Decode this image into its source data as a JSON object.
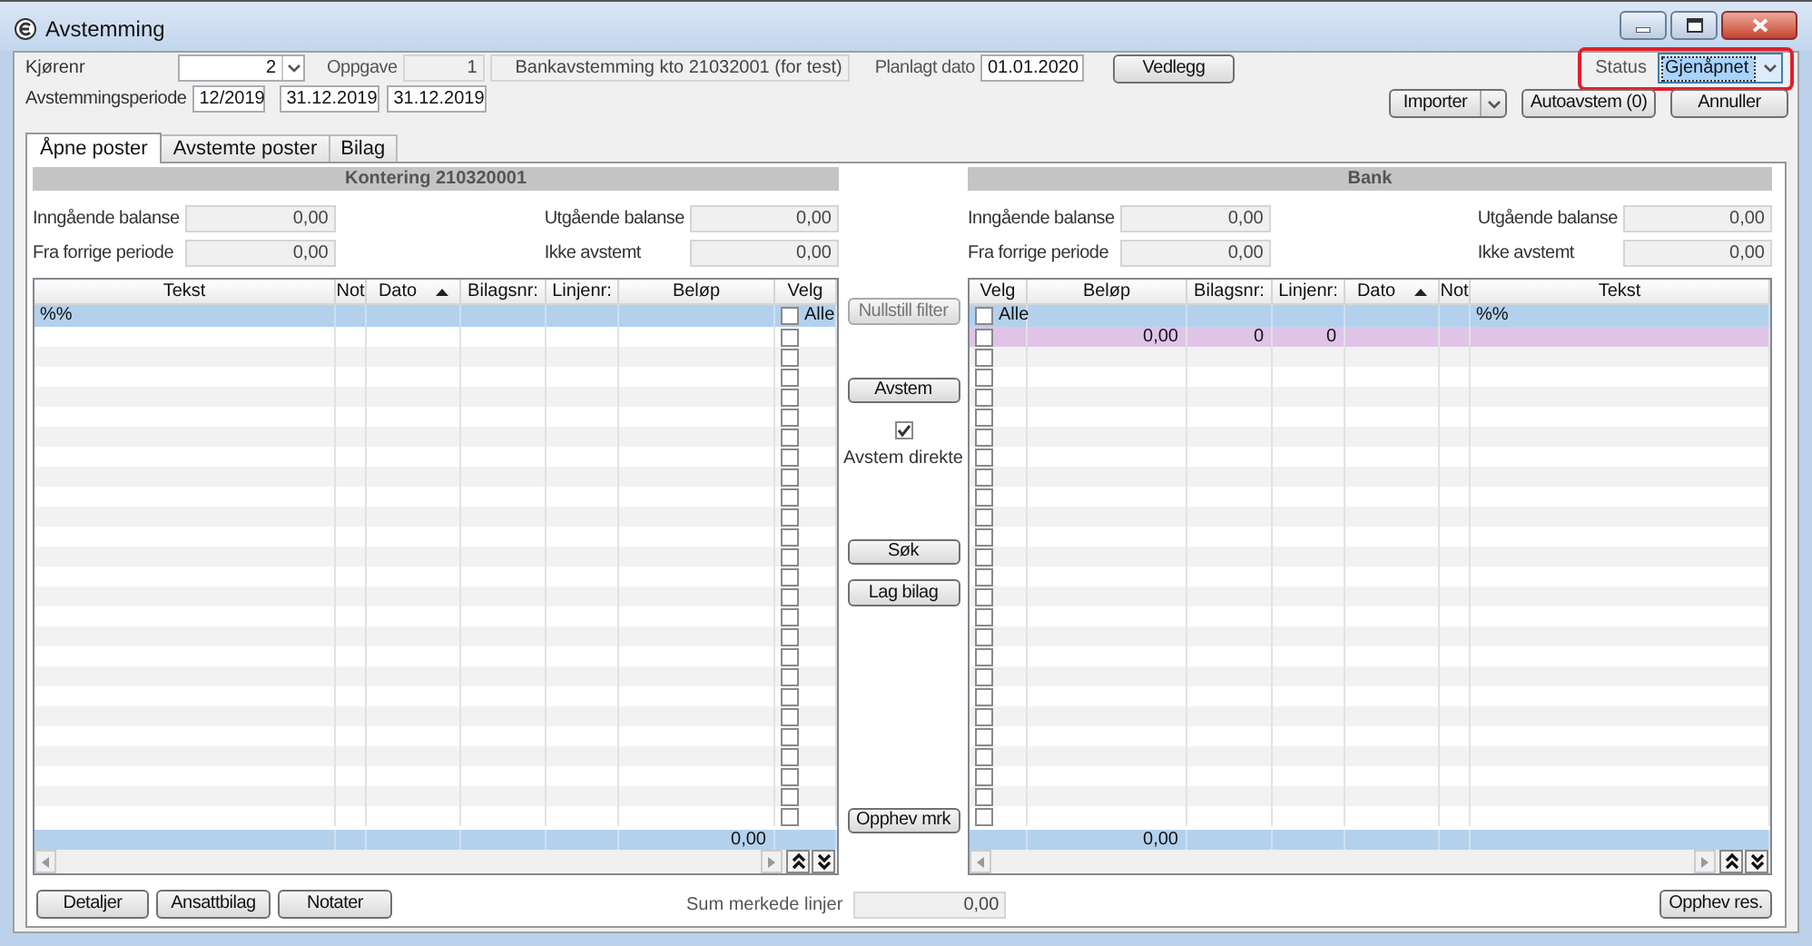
{
  "window": {
    "title": "Avstemming"
  },
  "header": {
    "kjorenr": {
      "label": "Kjørenr",
      "value": "2"
    },
    "oppgave": {
      "label": "Oppgave",
      "number": "1",
      "description": "Bankavstemming kto 21032001 (for test)"
    },
    "planlagt_dato": {
      "label": "Planlagt dato",
      "value": "01.01.2020"
    },
    "vedlegg_button": "Vedlegg",
    "status": {
      "label": "Status",
      "value": "Gjenåpnet",
      "highlighted": true
    },
    "period": {
      "label": "Avstemmingsperiode",
      "values": [
        "12/2019",
        "31.12.2019",
        "31.12.2019"
      ]
    },
    "buttons": [
      {
        "label": "Importer",
        "kind": "split"
      },
      {
        "label": "Autoavstem (0)",
        "kind": "plain"
      },
      {
        "label": "Annuller",
        "kind": "plain"
      }
    ]
  },
  "tabs": [
    {
      "label": "Åpne poster",
      "selected": true
    },
    {
      "label": "Avstemte poster",
      "selected": false
    },
    {
      "label": "Bilag",
      "selected": false
    }
  ],
  "left_panel": {
    "title": "Kontering 210320001",
    "balances": [
      {
        "label": "Inngående balanse",
        "value": "0,00"
      },
      {
        "label": "Fra forrige periode",
        "value": "0,00"
      },
      {
        "label": "Utgående balanse",
        "value": "0,00"
      },
      {
        "label": "Ikke avstemt",
        "value": "0,00"
      }
    ],
    "table": {
      "columns": [
        {
          "label": "Tekst",
          "kind": "text",
          "sorted_ascending": false
        },
        {
          "label": "Not",
          "kind": "note",
          "sorted_ascending": false
        },
        {
          "label": "Dato",
          "kind": "date",
          "sorted_ascending": true
        },
        {
          "label": "Bilagsnr:",
          "kind": "voucher",
          "sorted_ascending": false
        },
        {
          "label": "Linjenr:",
          "kind": "line",
          "sorted_ascending": false
        },
        {
          "label": "Beløp",
          "kind": "amount",
          "sorted_ascending": false
        },
        {
          "label": "Velg",
          "kind": "select",
          "sorted_ascending": false
        }
      ],
      "filter_row": {
        "text": "%%",
        "select_all_label": "Alle",
        "checked": false
      },
      "rows": [
        {
          "checked": false,
          "highlighted": false
        },
        {
          "checked": false,
          "highlighted": false
        },
        {
          "checked": false,
          "highlighted": false
        },
        {
          "checked": false,
          "highlighted": false
        },
        {
          "checked": false,
          "highlighted": false
        },
        {
          "checked": false,
          "highlighted": false
        },
        {
          "checked": false,
          "highlighted": false
        },
        {
          "checked": false,
          "highlighted": false
        },
        {
          "checked": false,
          "highlighted": false
        },
        {
          "checked": false,
          "highlighted": false
        },
        {
          "checked": false,
          "highlighted": false
        },
        {
          "checked": false,
          "highlighted": false
        },
        {
          "checked": false,
          "highlighted": false
        },
        {
          "checked": false,
          "highlighted": false
        },
        {
          "checked": false,
          "highlighted": false
        },
        {
          "checked": false,
          "highlighted": false
        },
        {
          "checked": false,
          "highlighted": false
        },
        {
          "checked": false,
          "highlighted": false
        },
        {
          "checked": false,
          "highlighted": false
        },
        {
          "checked": false,
          "highlighted": false
        },
        {
          "checked": false,
          "highlighted": false
        },
        {
          "checked": false,
          "highlighted": false
        },
        {
          "checked": false,
          "highlighted": false
        },
        {
          "checked": false,
          "highlighted": false
        },
        {
          "checked": false,
          "highlighted": false
        }
      ],
      "total": {
        "amount": "0,00"
      }
    }
  },
  "middle": {
    "buttons": [
      {
        "label": "Nullstill filter",
        "disabled": true
      },
      {
        "label": "Avstem",
        "disabled": false
      }
    ],
    "avstem_direkte": {
      "label": "Avstem direkte",
      "checked": true
    },
    "buttons_2": [
      {
        "label": "Søk",
        "disabled": false
      },
      {
        "label": "Lag bilag",
        "disabled": false
      }
    ],
    "opphev_mrk": "Opphev mrk"
  },
  "right_panel": {
    "title": "Bank",
    "balances": [
      {
        "label": "Inngående balanse",
        "value": "0,00"
      },
      {
        "label": "Fra forrige periode",
        "value": "0,00"
      },
      {
        "label": "Utgående balanse",
        "value": "0,00"
      },
      {
        "label": "Ikke avstemt",
        "value": "0,00"
      }
    ],
    "table": {
      "columns": [
        {
          "label": "Velg",
          "kind": "select",
          "sorted_ascending": false
        },
        {
          "label": "Beløp",
          "kind": "amount",
          "sorted_ascending": false
        },
        {
          "label": "Bilagsnr:",
          "kind": "voucher",
          "sorted_ascending": false
        },
        {
          "label": "Linjenr:",
          "kind": "line",
          "sorted_ascending": false
        },
        {
          "label": "Dato",
          "kind": "date",
          "sorted_ascending": true
        },
        {
          "label": "Not",
          "kind": "note",
          "sorted_ascending": false
        },
        {
          "label": "Tekst",
          "kind": "text",
          "sorted_ascending": false
        }
      ],
      "filter_row": {
        "text": "%%",
        "select_all_label": "Alle",
        "checked": false
      },
      "rows": [
        {
          "checked": false,
          "highlighted": true,
          "amount": "0,00",
          "voucher": "0",
          "line": "0"
        },
        {
          "checked": false,
          "highlighted": false
        },
        {
          "checked": false,
          "highlighted": false
        },
        {
          "checked": false,
          "highlighted": false
        },
        {
          "checked": false,
          "highlighted": false
        },
        {
          "checked": false,
          "highlighted": false
        },
        {
          "checked": false,
          "highlighted": false
        },
        {
          "checked": false,
          "highlighted": false
        },
        {
          "checked": false,
          "highlighted": false
        },
        {
          "checked": false,
          "highlighted": false
        },
        {
          "checked": false,
          "highlighted": false
        },
        {
          "checked": false,
          "highlighted": false
        },
        {
          "checked": false,
          "highlighted": false
        },
        {
          "checked": false,
          "highlighted": false
        },
        {
          "checked": false,
          "highlighted": false
        },
        {
          "checked": false,
          "highlighted": false
        },
        {
          "checked": false,
          "highlighted": false
        },
        {
          "checked": false,
          "highlighted": false
        },
        {
          "checked": false,
          "highlighted": false
        },
        {
          "checked": false,
          "highlighted": false
        },
        {
          "checked": false,
          "highlighted": false
        },
        {
          "checked": false,
          "highlighted": false
        },
        {
          "checked": false,
          "highlighted": false
        },
        {
          "checked": false,
          "highlighted": false
        },
        {
          "checked": false,
          "highlighted": false
        }
      ],
      "total": {
        "amount": "0,00"
      }
    }
  },
  "footer": {
    "buttons": [
      "Detaljer",
      "Ansattbilag",
      "Notater"
    ],
    "sum": {
      "label": "Sum merkede linjer",
      "value": "0,00"
    },
    "opphev_res": "Opphev res."
  }
}
